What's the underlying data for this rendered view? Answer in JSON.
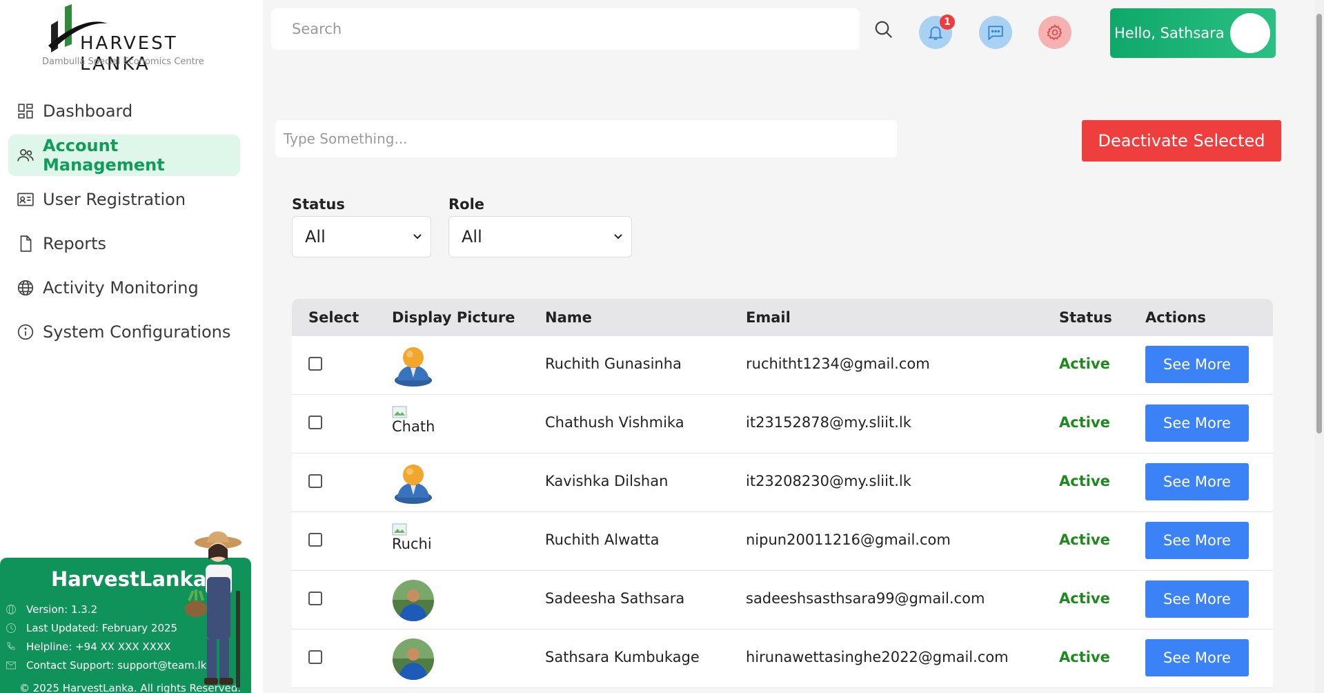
{
  "brand": {
    "name": "HARVEST LANKA",
    "subtitle": "Dambulla Special Economics Centre",
    "colors": {
      "primary": "#10935a",
      "accent": "#3b82f6",
      "danger": "#ee3e3e"
    }
  },
  "sidebar": {
    "items": [
      {
        "label": "Dashboard",
        "icon": "dashboard-icon",
        "active": false
      },
      {
        "label": "Account Management",
        "icon": "users-icon",
        "active": true
      },
      {
        "label": "User Registration",
        "icon": "id-card-icon",
        "active": false
      },
      {
        "label": "Reports",
        "icon": "file-icon",
        "active": false
      },
      {
        "label": "Activity Monitoring",
        "icon": "globe-icon",
        "active": false
      },
      {
        "label": "System Configurations",
        "icon": "info-icon",
        "active": false
      }
    ]
  },
  "info_card": {
    "title": "HarvestLanka",
    "version": "Version: 1.3.2",
    "updated": "Last Updated: February 2025",
    "helpline": "Helpline: +94 XX XXX XXXX",
    "support": "Contact Support: support@team.lk",
    "copyright": "© 2025 HarvestLanka. All rights Reserved."
  },
  "topbar": {
    "search_placeholder": "Search",
    "notification_count": "1",
    "greeting": "Hello, Sathsara"
  },
  "content": {
    "filter_placeholder": "Type Something...",
    "deactivate_label": "Deactivate Selected",
    "status_filter": {
      "label": "Status",
      "value": "All"
    },
    "role_filter": {
      "label": "Role",
      "value": "All"
    }
  },
  "table": {
    "headers": {
      "select": "Select",
      "picture": "Display Picture",
      "name": "Name",
      "email": "Email",
      "status": "Status",
      "actions": "Actions"
    },
    "rows": [
      {
        "picture": "default-avatar",
        "alt": "",
        "name": "Ruchith Gunasinha",
        "email": "ruchitht1234@gmail.com",
        "status": "Active",
        "action": "See More"
      },
      {
        "picture": "broken-image",
        "alt": "Chath",
        "name": "Chathush Vishmika",
        "email": "it23152878@my.sliit.lk",
        "status": "Active",
        "action": "See More"
      },
      {
        "picture": "default-avatar",
        "alt": "",
        "name": "Kavishka Dilshan",
        "email": "it23208230@my.sliit.lk",
        "status": "Active",
        "action": "See More"
      },
      {
        "picture": "broken-image",
        "alt": "Ruchi",
        "name": "Ruchith Alwatta",
        "email": "nipun20011216@gmail.com",
        "status": "Active",
        "action": "See More"
      },
      {
        "picture": "photo-avatar",
        "alt": "",
        "name": "Sadeesha Sathsara",
        "email": "sadeeshsasthsara99@gmail.com",
        "status": "Active",
        "action": "See More"
      },
      {
        "picture": "photo-avatar",
        "alt": "",
        "name": "Sathsara Kumbukage",
        "email": "hirunawettasinghe2022@gmail.com",
        "status": "Active",
        "action": "See More"
      }
    ]
  }
}
